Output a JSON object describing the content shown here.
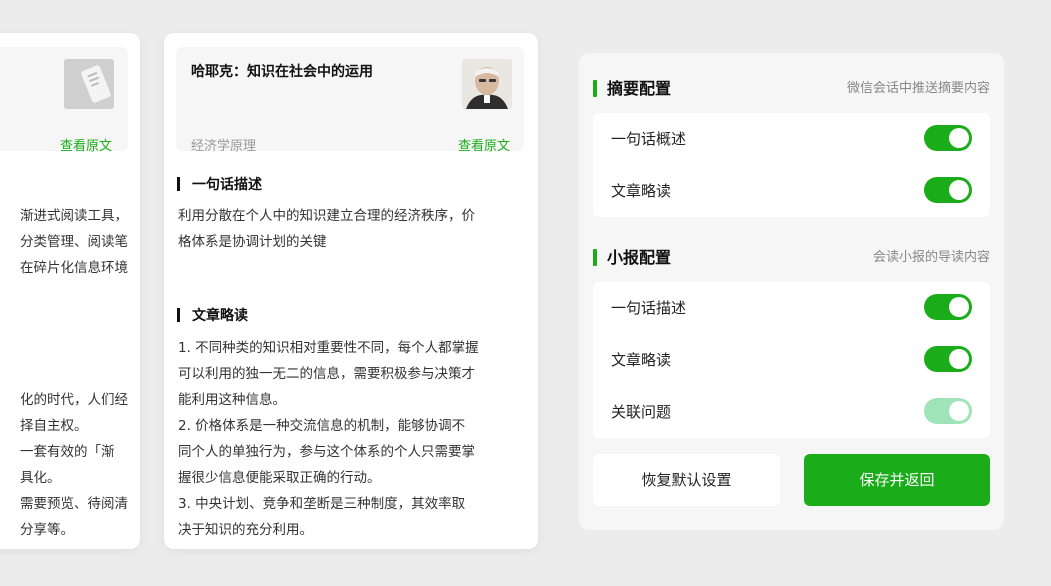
{
  "left_card": {
    "link": "查看原文",
    "lines_a": [
      "渐进式阅读工具，",
      "分类管理、阅读笔",
      "在碎片化信息环境"
    ],
    "lines_b": [
      "化的时代，人们经",
      "择自主权。",
      "一套有效的「渐",
      "具化。",
      "需要预览、待阅清",
      "分享等。"
    ]
  },
  "article": {
    "title": "哈耶克：知识在社会中的运用",
    "category": "经济学原理",
    "link": "查看原文",
    "section1_title": "一句话描述",
    "section1_text": "利用分散在个人中的知识建立合理的经济秩序，价\n格体系是协调计划的关键",
    "section2_title": "文章略读",
    "section2_text": "1. 不同种类的知识相对重要性不同，每个人都掌握\n可以利用的独一无二的信息，需要积极参与决策才\n能利用这种信息。\n2. 价格体系是一种交流信息的机制，能够协调不\n同个人的单独行为，参与这个体系的个人只需要掌\n握很少信息便能采取正确的行动。\n3. 中央计划、竞争和垄断是三种制度，其效率取\n决于知识的充分利用。"
  },
  "settings": {
    "summary": {
      "title": "摘要配置",
      "subtitle": "微信会话中推送摘要内容",
      "items": [
        {
          "label": "一句话概述",
          "on": true
        },
        {
          "label": "文章略读",
          "on": true
        }
      ]
    },
    "brief": {
      "title": "小报配置",
      "subtitle": "会读小报的导读内容",
      "items": [
        {
          "label": "一句话描述",
          "on": true
        },
        {
          "label": "文章略读",
          "on": true
        },
        {
          "label": "关联问题",
          "on": true,
          "disabled": true
        }
      ]
    },
    "reset_label": "恢复默认设置",
    "save_label": "保存并返回"
  },
  "colors": {
    "accent": "#1aad19",
    "accent_dim": "#9fe3b9",
    "background": "#ececec"
  }
}
